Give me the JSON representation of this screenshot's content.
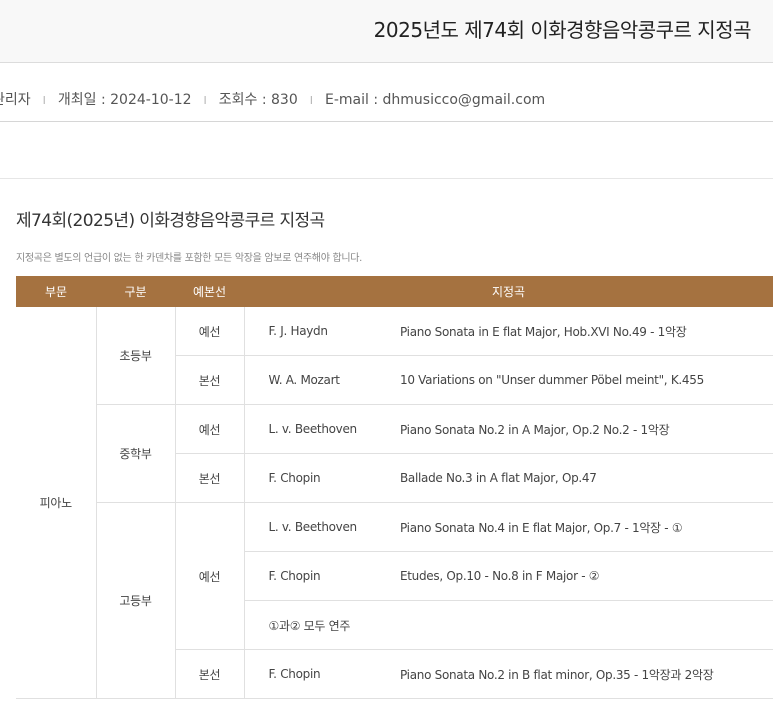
{
  "page_title": "2025년도 제74회 이화경향음악콩쿠르 지정곡",
  "meta": {
    "author": "관리자",
    "date": "개최일 : 2024-10-12",
    "views": "조회수 : 830",
    "email": "E-mail : dhmusicco@gmail.com",
    "separator": "I"
  },
  "section_title": "제74회(2025년) 이화경향음악콩쿠르 지정곡",
  "note": "지정곡은 별도의 언급이 없는 한 카덴차를 포함한 모든 악장을 암보로 연주해야 합니다.",
  "table": {
    "headers": [
      "부문",
      "구분",
      "예본선",
      "지정곡"
    ],
    "division": "피아노",
    "groups": [
      "초등부",
      "중학부",
      "고등부"
    ],
    "rounds": {
      "prelim": "예선",
      "final": "본선"
    },
    "rows": [
      {
        "composer": "F. J. Haydn",
        "piece": "Piano Sonata in E flat Major, Hob.XVI No.49 - 1악장"
      },
      {
        "composer": "W. A. Mozart",
        "piece": "10 Variations on \"Unser dummer Pöbel meint\", K.455"
      },
      {
        "composer": "L. v. Beethoven",
        "piece": "Piano Sonata No.2 in A Major, Op.2 No.2 - 1악장"
      },
      {
        "composer": "F. Chopin",
        "piece": "Ballade No.3 in A flat Major, Op.47"
      },
      {
        "composer": "L. v. Beethoven",
        "piece": "Piano Sonata No.4 in E flat Major, Op.7 - 1악장 - ①"
      },
      {
        "composer": "F. Chopin",
        "piece": "Etudes, Op.10 - No.8 in F Major - ②"
      },
      {
        "composer": "F. Chopin",
        "piece": "Piano Sonata No.2 in B flat minor, Op.35 - 1악장과 2악장"
      }
    ],
    "both_note": "①과② 모두 연주"
  },
  "colors": {
    "header_bg": "#a57240",
    "title_bar_bg": "#f8f8f8"
  }
}
